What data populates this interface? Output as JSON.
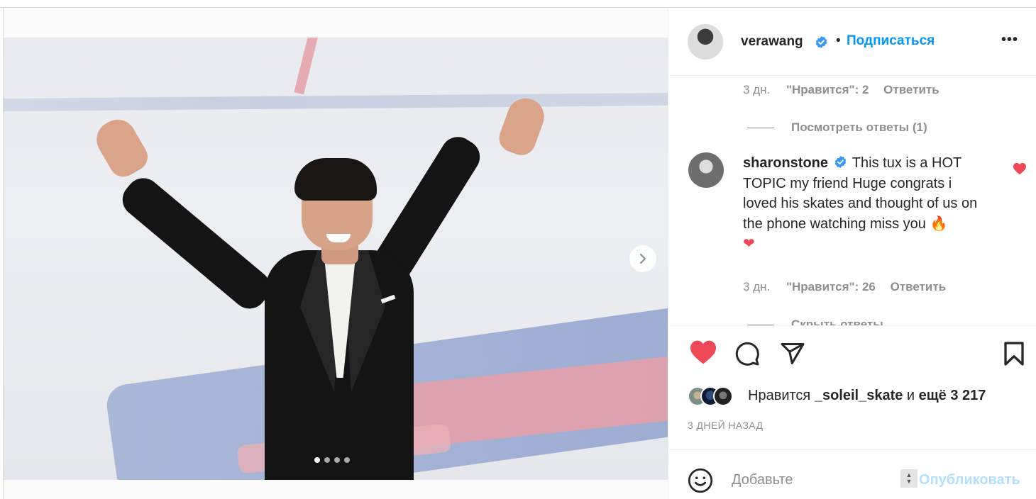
{
  "post": {
    "author": "verawang",
    "separator": "•",
    "follow_label": "Подписаться",
    "more_label": "•••",
    "carousel": {
      "slides": 4,
      "active_slide": 1
    }
  },
  "comments": {
    "prev_meta": {
      "time": "3 дн.",
      "likes": "\"Нравится\": 2",
      "reply": "Ответить"
    },
    "prev_view_replies": "Посмотреть ответы (1)",
    "main": {
      "username": "sharonstone",
      "text": "This tux is a HOT TOPIC my friend Huge congrats i loved his skates and thought of us on the phone watching miss you",
      "emoji_fire": "🔥",
      "emoji_heart": "❤",
      "time": "3 дн.",
      "likes": "\"Нравится\": 26",
      "reply": "Ответить",
      "hide_replies": "Скрыть ответы"
    }
  },
  "actions": {
    "liked_by_prefix": "Нравится",
    "liked_by_user": "_soleil_skate",
    "liked_by_and": "и",
    "liked_by_more": "ещё 3 217",
    "date": "3 ДНЕЙ НАЗАД"
  },
  "add_comment": {
    "placeholder": "Добавьте",
    "publish_label": "Опубликовать"
  },
  "colors": {
    "accent": "#0095f6",
    "like_red": "#ed4956",
    "muted": "#8e8e8e",
    "verified_blue": "#3897f0"
  },
  "icons": [
    "chevron-right-icon",
    "verified-icon",
    "heart-icon",
    "comment-icon",
    "share-icon",
    "bookmark-icon",
    "emoji-icon"
  ]
}
